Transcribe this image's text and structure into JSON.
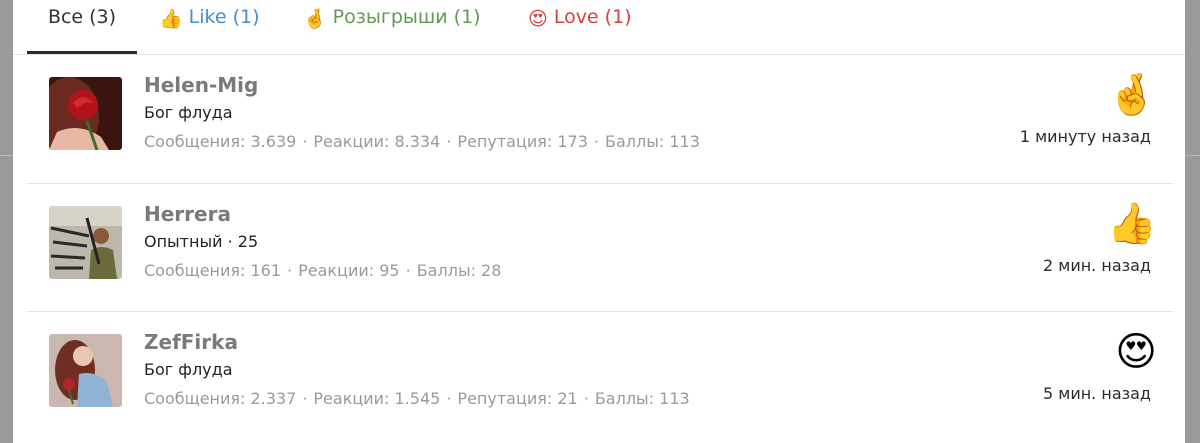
{
  "tabs": [
    {
      "label": "Все (3)"
    },
    {
      "icon": "👍",
      "label": "Like (1)"
    },
    {
      "icon": "🤞",
      "label": "Розыгрыши (1)"
    },
    {
      "icon": "😍",
      "label": "Love (1)"
    }
  ],
  "colors": {
    "like": "#3f8fd1",
    "draw": "#5f9c53",
    "love": "#d64040"
  },
  "entries": [
    {
      "name": "Helen-Mig",
      "title": "Бог флуда",
      "stats": [
        "Сообщения: 3.639",
        "Реакции: 8.334",
        "Репутация: 173",
        "Баллы: 113"
      ],
      "reaction_icon": "🤞",
      "time": "1 минуту назад"
    },
    {
      "name": "Herrera",
      "title": "Опытный · 25",
      "stats": [
        "Сообщения: 161",
        "Реакции: 95",
        "Баллы: 28"
      ],
      "reaction_icon": "👍",
      "time": "2 мин. назад"
    },
    {
      "name": "ZefFirka",
      "title": "Бог флуда",
      "stats": [
        "Сообщения: 2.337",
        "Реакции: 1.545",
        "Репутация: 21",
        "Баллы: 113"
      ],
      "reaction_icon": "😍",
      "time": "5 мин. назад"
    }
  ]
}
